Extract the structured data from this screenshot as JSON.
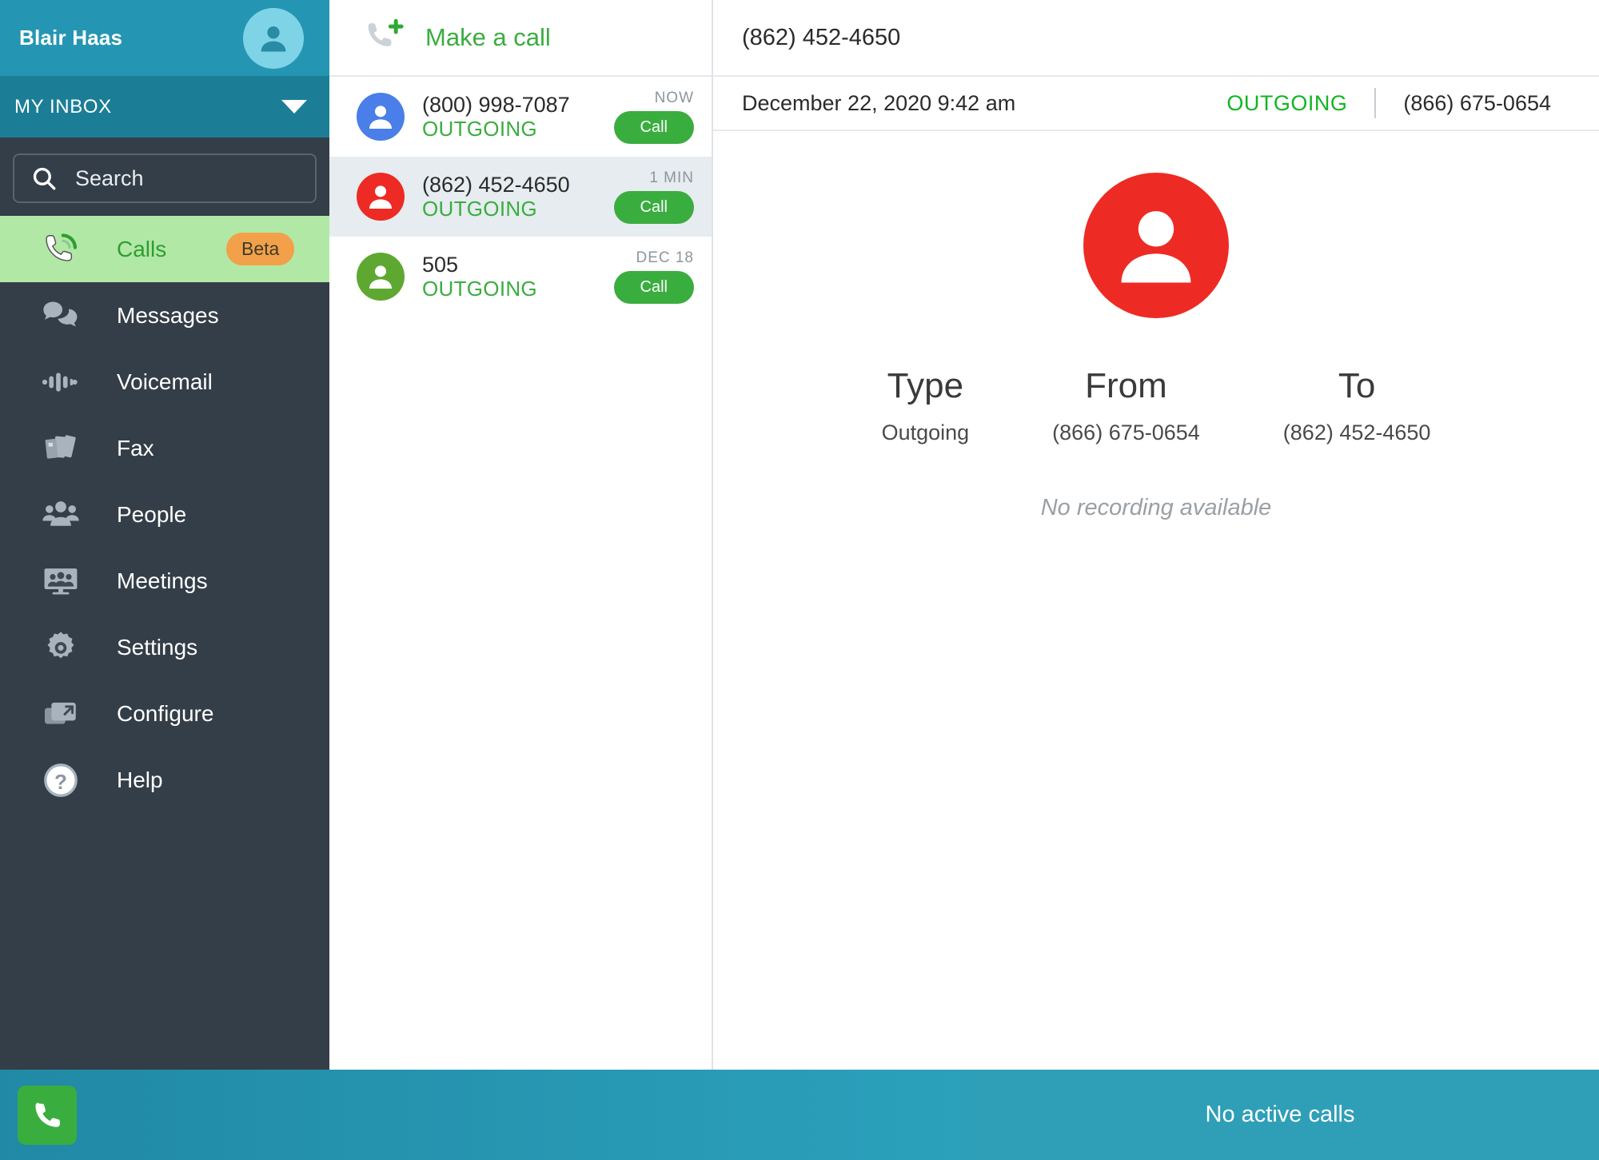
{
  "sidebar": {
    "user": {
      "name": "Blair Haas",
      "avatar_icon": "user-avatar-icon"
    },
    "inbox": {
      "label": "MY INBOX",
      "caret_icon": "chevron-down-icon"
    },
    "search": {
      "placeholder": "Search",
      "value": "Search",
      "icon": "search-icon"
    },
    "items": [
      {
        "label": "Calls",
        "icon": "phone-ring-icon",
        "badge": "Beta",
        "active": true
      },
      {
        "label": "Messages",
        "icon": "chat-bubbles-icon",
        "active": false
      },
      {
        "label": "Voicemail",
        "icon": "waveform-icon",
        "active": false
      },
      {
        "label": "Fax",
        "icon": "fax-pages-icon",
        "active": false
      },
      {
        "label": "People",
        "icon": "people-group-icon",
        "active": false
      },
      {
        "label": "Meetings",
        "icon": "video-meeting-icon",
        "active": false
      },
      {
        "label": "Settings",
        "icon": "gear-icon",
        "active": false
      },
      {
        "label": "Configure",
        "icon": "windows-arrow-icon",
        "active": false
      },
      {
        "label": "Help",
        "icon": "question-circle-icon",
        "active": false
      }
    ],
    "colors": {
      "header_bg": "#2496b3",
      "inbox_bg": "#1b7e96",
      "nav_bg": "#343e48",
      "active_bg": "#b2e8a5",
      "badge_bg": "#f3a04a"
    }
  },
  "call_list": {
    "make_call_label": "Make a call",
    "make_call_icon": "phone-plus-icon",
    "call_button_label": "Call",
    "rows": [
      {
        "number": "(800) 998-7087",
        "status": "OUTGOING",
        "time": "NOW",
        "avatar_color": "#4a7ee8",
        "selected": false
      },
      {
        "number": "(862) 452-4650",
        "status": "OUTGOING",
        "time": "1 MIN",
        "avatar_color": "#ee2a24",
        "selected": true
      },
      {
        "number": "505",
        "status": "OUTGOING",
        "time": "DEC 18",
        "avatar_color": "#5ea832",
        "selected": false
      }
    ]
  },
  "detail": {
    "title": "(862) 452-4650",
    "date": "December 22, 2020 9:42 am",
    "direction": "OUTGOING",
    "from_number": "(866) 675-0654",
    "avatar_color": "#ee2a24",
    "avatar_icon": "user-avatar-icon",
    "fields": [
      {
        "label": "Type",
        "value": "Outgoing"
      },
      {
        "label": "From",
        "value": "(866) 675-0654"
      },
      {
        "label": "To",
        "value": "(862) 452-4650"
      }
    ],
    "no_recording": "No recording available"
  },
  "status_bar": {
    "phone_icon": "phone-icon",
    "text": "No active calls",
    "colors": {
      "bar_bg": "#2189a5",
      "right_bg": "#2f9fb8",
      "phone_btn": "#3aad3f"
    }
  }
}
